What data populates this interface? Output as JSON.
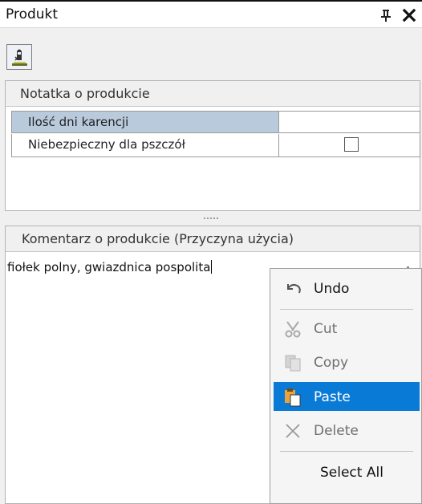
{
  "panel": {
    "title": "Produkt",
    "pin_icon": "pin-icon",
    "close_icon": "close-icon"
  },
  "toolbar": {
    "button_icon": "product-tool-icon"
  },
  "note_group": {
    "header": "Notatka o produkcie",
    "rows": [
      {
        "label": "Ilość dni karencji",
        "value": ""
      },
      {
        "label": "Niebezpieczny dla pszczół",
        "checked": false
      }
    ]
  },
  "comment_group": {
    "header": "Komentarz o produkcie (Przyczyna użycia)",
    "text": "fiołek polny, gwiazdnica pospolita"
  },
  "context_menu": {
    "items": [
      {
        "label": "Undo",
        "icon": "undo-icon",
        "enabled": true
      },
      {
        "label": "Cut",
        "icon": "cut-icon",
        "enabled": false
      },
      {
        "label": "Copy",
        "icon": "copy-icon",
        "enabled": false
      },
      {
        "label": "Paste",
        "icon": "paste-icon",
        "enabled": true,
        "highlighted": true
      },
      {
        "label": "Delete",
        "icon": "delete-icon",
        "enabled": false
      },
      {
        "label": "Select All",
        "enabled": true
      }
    ]
  },
  "colors": {
    "selection": "#0a7ad7",
    "row_highlight": "#b9cadc",
    "panel_bg": "#f0f0f0"
  }
}
